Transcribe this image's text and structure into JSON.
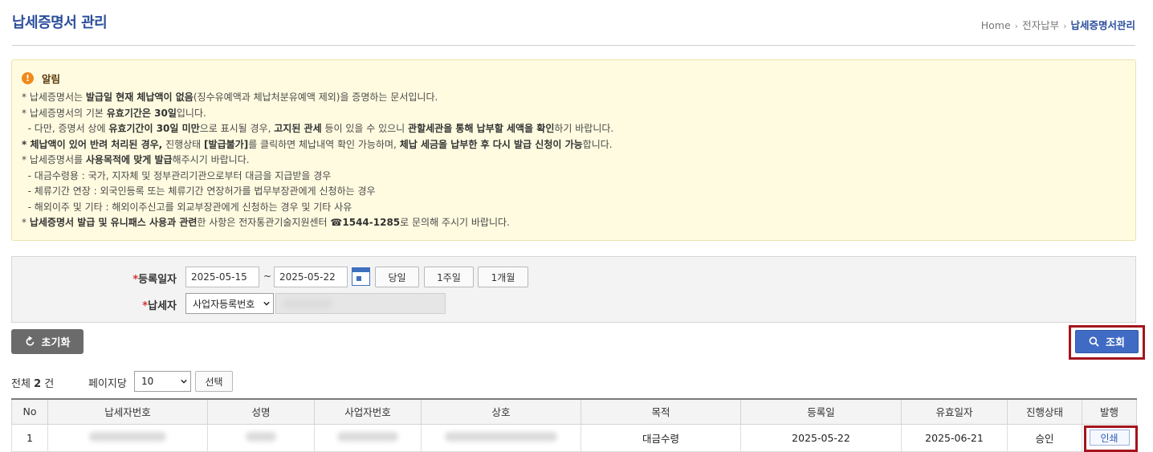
{
  "header": {
    "title": "납세증명서 관리",
    "breadcrumb": [
      "Home",
      "전자납부",
      "납세증명서관리"
    ]
  },
  "notice": {
    "title": "알림",
    "lines": [
      [
        {
          "t": "* 납세증명서는 "
        },
        {
          "t": "발급일 현재 체납액이 없음",
          "b": true
        },
        {
          "t": "(징수유예액과 체납처분유예액 제외)을 증명하는 문서입니다."
        }
      ],
      [
        {
          "t": "* 납세증명서의 기본 "
        },
        {
          "t": "유효기간은 30일",
          "b": true
        },
        {
          "t": "입니다."
        }
      ],
      [
        {
          "t": "  - 다만, 증명서 상에 "
        },
        {
          "t": "유효기간이 30일 미만",
          "b": true
        },
        {
          "t": "으로 표시될 경우, "
        },
        {
          "t": "고지된 관세",
          "b": true
        },
        {
          "t": " 등이 있을 수 있으니 "
        },
        {
          "t": "관할세관을 통해 납부할 세액을 확인",
          "b": true
        },
        {
          "t": "하기 바랍니다."
        }
      ],
      [
        {
          "t": "* 체납액이 있어 반려 처리된 경우,",
          "b": true
        },
        {
          "t": " 진행상태 "
        },
        {
          "t": "[발급불가]",
          "b": true
        },
        {
          "t": "를 클릭하면 체납내역 확인 가능하며, "
        },
        {
          "t": "체납 세금을 납부한 후 다시 발급 신청이 가능",
          "b": true
        },
        {
          "t": "합니다."
        }
      ],
      [
        {
          "t": "* 납세증명서를 "
        },
        {
          "t": "사용목적에 맞게 발급",
          "b": true
        },
        {
          "t": "해주시기 바랍니다."
        }
      ],
      [
        {
          "t": "  - 대금수령용 : 국가, 지자체 및 정부관리기관으로부터 대금을 지급받을 경우"
        }
      ],
      [
        {
          "t": "  - 체류기간 연장 : 외국인등록 또는 체류기간 연장허가를 법무부장관에게 신청하는 경우"
        }
      ],
      [
        {
          "t": "  - 해외이주 및 기타 : 해외이주신고를 외교부장관에게 신청하는 경우 및 기타 사유"
        }
      ],
      [
        {
          "t": "* "
        },
        {
          "t": "납세증명서 발급 및 유니패스 사용과 관련",
          "b": true
        },
        {
          "t": "한 사항은 전자통관기술지원센터 "
        },
        {
          "t": "☎1544-1285",
          "b": true
        },
        {
          "t": "로 문의해 주시기 바랍니다."
        }
      ]
    ]
  },
  "search": {
    "date_label": "등록일자",
    "start_date": "2025-05-15",
    "tilde": "~",
    "end_date": "2025-05-22",
    "today_btn": "당일",
    "week_btn": "1주일",
    "month_btn": "1개월",
    "taxpayer_label": "납세자",
    "taxpayer_type": "사업자등록번호",
    "required_mark": "*"
  },
  "actions": {
    "reset_label": "초기화",
    "search_label": "조회"
  },
  "list_info": {
    "total_prefix": "전체 ",
    "total_count": "2",
    "total_suffix": " 건",
    "per_page_label": "페이지당",
    "per_page_value": "10",
    "select_label": "선택"
  },
  "table": {
    "columns": [
      "No",
      "납세자번호",
      "성명",
      "사업자번호",
      "상호",
      "목적",
      "등록일",
      "유효일자",
      "진행상태",
      "발행"
    ],
    "rows": [
      {
        "no": "1",
        "purpose": "대금수령",
        "reg_date": "2025-05-22",
        "valid_date": "2025-06-21",
        "status": "승인",
        "issue": "인쇄"
      }
    ]
  },
  "colors": {
    "title_blue": "#2d4f9c",
    "notice_bg": "#fffbe0",
    "highlight_red": "#a4141c",
    "search_blue": "#3f6bc4"
  }
}
